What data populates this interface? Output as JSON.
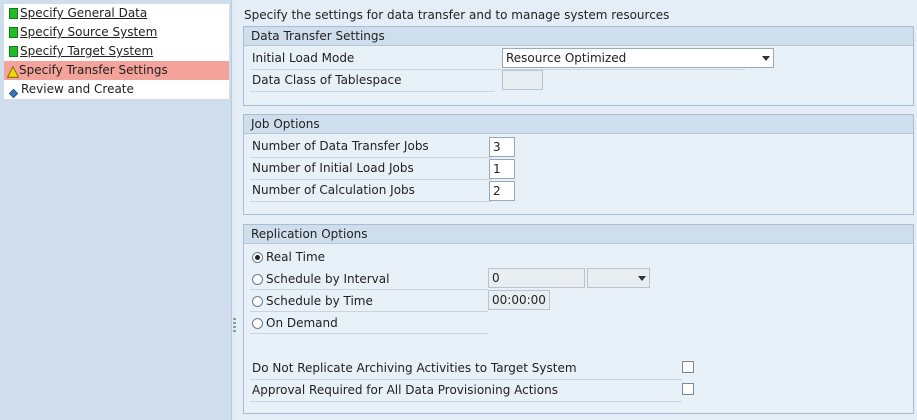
{
  "nav": {
    "items": [
      {
        "label": "Specify General Data",
        "status": "done"
      },
      {
        "label": "Specify Source System",
        "status": "done"
      },
      {
        "label": "Specify Target System",
        "status": "done"
      },
      {
        "label": "Specify Transfer Settings",
        "status": "warning"
      },
      {
        "label": "Review and Create",
        "status": "pending"
      }
    ]
  },
  "page": {
    "title": "Specify the settings for data transfer and to manage system resources"
  },
  "data_transfer": {
    "header": "Data Transfer Settings",
    "initial_load_mode_label": "Initial Load Mode",
    "initial_load_mode_value": "Resource Optimized",
    "data_class_label": "Data Class of Tablespace",
    "data_class_value": ""
  },
  "job_options": {
    "header": "Job Options",
    "data_transfer_jobs_label": "Number of Data Transfer Jobs",
    "data_transfer_jobs_value": "3",
    "initial_load_jobs_label": "Number of Initial Load Jobs",
    "initial_load_jobs_value": "1",
    "calculation_jobs_label": "Number of Calculation Jobs",
    "calculation_jobs_value": "2"
  },
  "replication": {
    "header": "Replication Options",
    "real_time_label": "Real Time",
    "interval_label": "Schedule by Interval",
    "interval_value": "0",
    "interval_unit_value": "",
    "time_label": "Schedule by Time",
    "time_value": "00:00:00",
    "on_demand_label": "On Demand",
    "selected": "Real Time",
    "archiving_label": "Do Not Replicate Archiving Activities to Target System",
    "archiving_checked": false,
    "approval_label": "Approval Required for All Data Provisioning Actions",
    "approval_checked": false
  },
  "colors": {
    "done": "#1fbd2a",
    "warning": "#f5d800",
    "pending": "#3a73b8",
    "active_row": "#f3a39a"
  }
}
